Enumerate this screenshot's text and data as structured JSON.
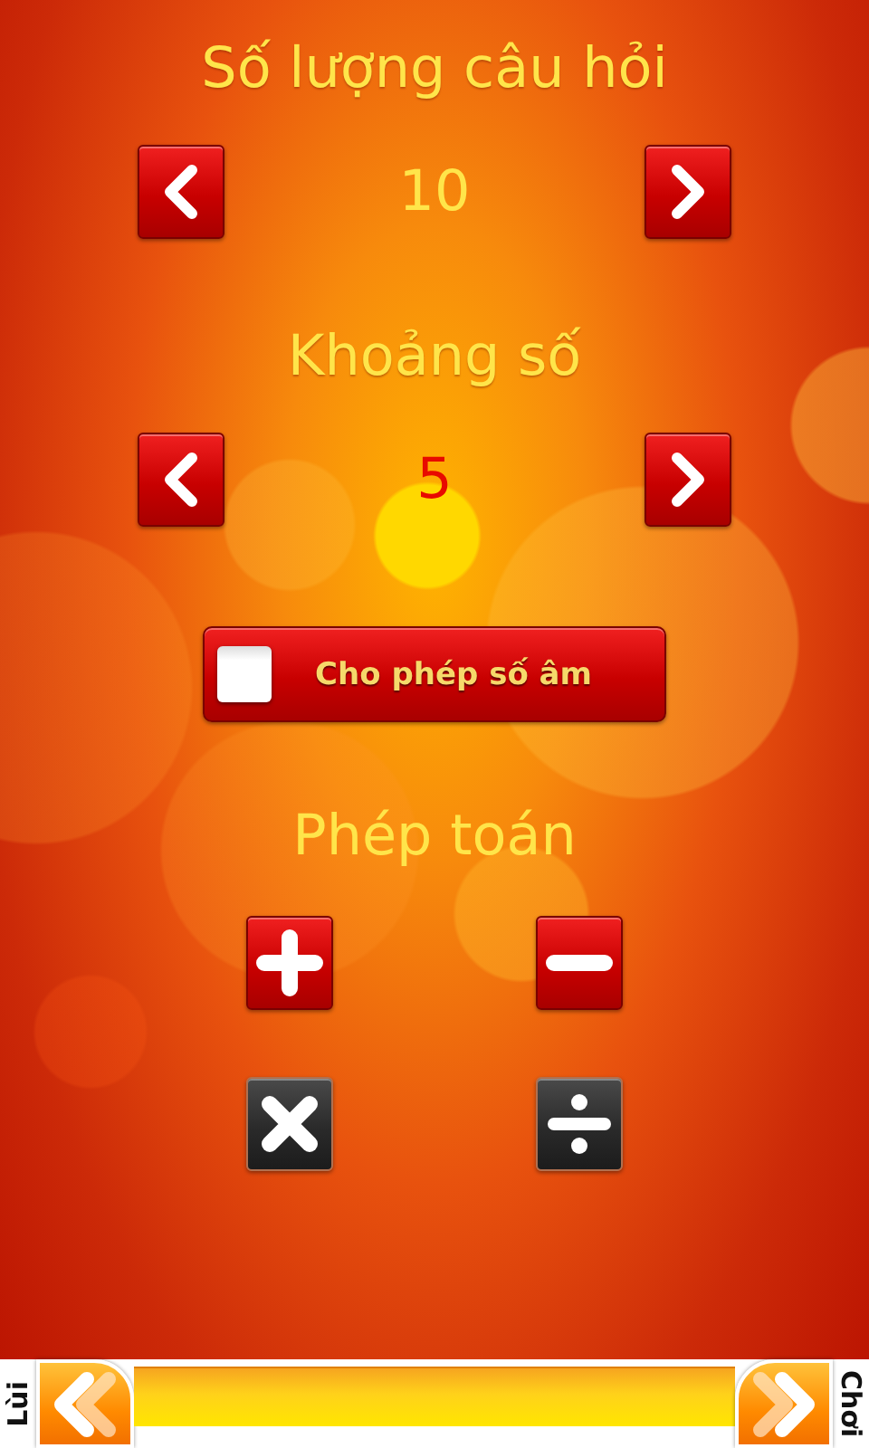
{
  "settings": [
    {
      "title": "Số lượng câu hỏi",
      "value": "10",
      "highlighted": false
    },
    {
      "title": "Khoảng số",
      "value": "5",
      "highlighted": true
    }
  ],
  "negative_toggle": {
    "label": "Cho phép số âm",
    "checked": false
  },
  "operations": {
    "title": "Phép toán",
    "items": [
      {
        "kind": "add",
        "selected": true
      },
      {
        "kind": "subtract",
        "selected": true
      },
      {
        "kind": "multiply",
        "selected": false
      },
      {
        "kind": "divide",
        "selected": false
      }
    ]
  },
  "footer": {
    "back_label": "Lùi",
    "play_label": "Chơi"
  }
}
